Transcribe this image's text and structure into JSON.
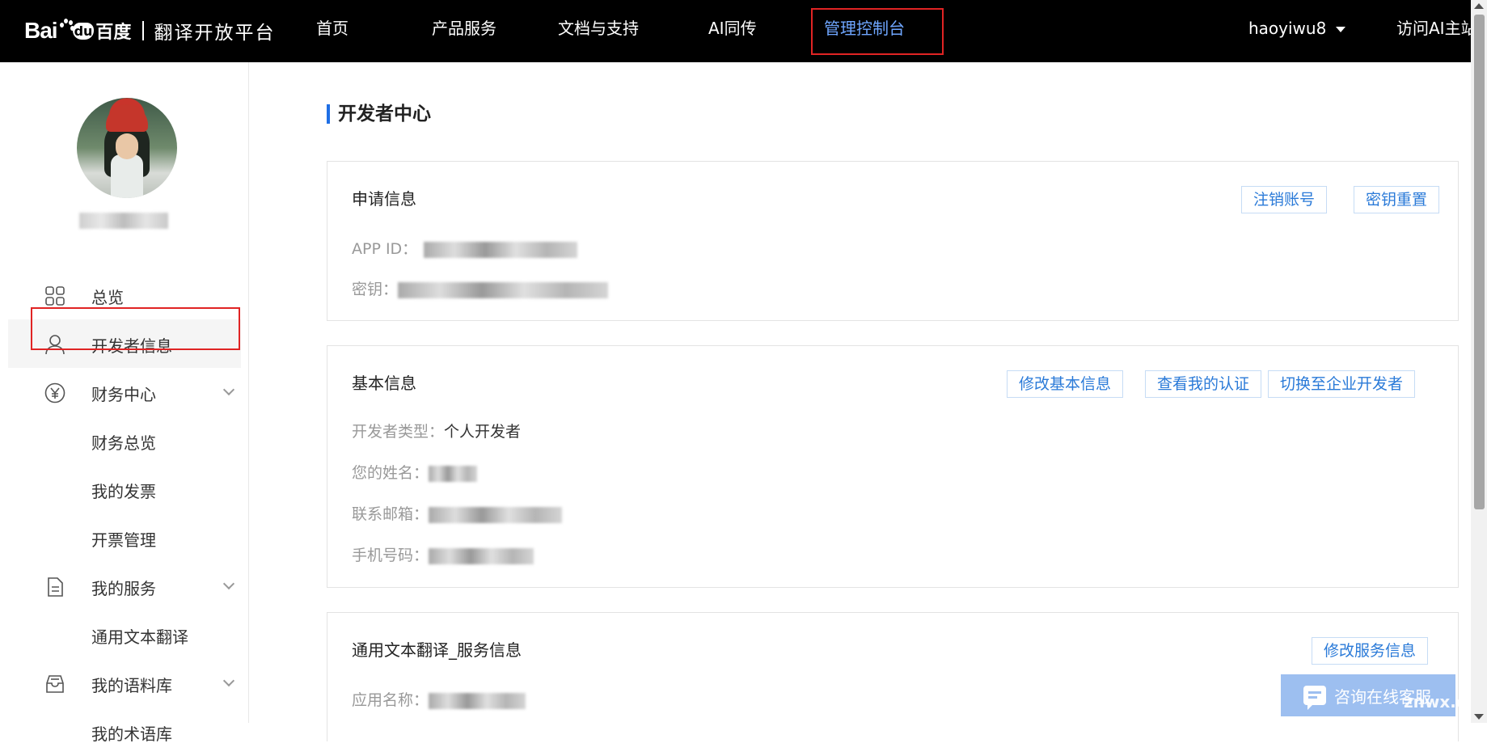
{
  "header": {
    "logo_latin": "Bai",
    "logo_du": "du",
    "logo_cn": "百度",
    "platform_title": "翻译开放平台",
    "nav": [
      "首页",
      "产品服务",
      "文档与支持",
      "AI同传",
      "管理控制台"
    ],
    "username": "haoyiwu8",
    "visit_link": "访问AI主站"
  },
  "sidebar": {
    "menu": {
      "overview": "总览",
      "developer_info": "开发者信息",
      "finance_center": "财务中心",
      "finance_overview": "财务总览",
      "my_invoices": "我的发票",
      "invoice_management": "开票管理",
      "my_services": "我的服务",
      "general_text_translation": "通用文本翻译",
      "my_corpus": "我的语料库",
      "my_terminology": "我的术语库"
    }
  },
  "main": {
    "page_title": "开发者中心",
    "application_info": {
      "title": "申请信息",
      "cancel_account": "注销账号",
      "reset_key": "密钥重置",
      "app_id_label": "APP ID：",
      "key_label": "密钥："
    },
    "basic_info": {
      "title": "基本信息",
      "edit_basic_info": "修改基本信息",
      "view_certification": "查看我的认证",
      "switch_enterprise": "切换至企业开发者",
      "developer_type_label": "开发者类型：",
      "developer_type_value": "个人开发者",
      "name_label": "您的姓名：",
      "email_label": "联系邮箱：",
      "phone_label": "手机号码："
    },
    "service_info": {
      "title": "通用文本翻译_服务信息",
      "edit_service_info": "修改服务信息",
      "app_name_label": "应用名称："
    }
  },
  "chat_widget": {
    "label": "咨询在线客服",
    "watermark": "znwx.cn"
  }
}
